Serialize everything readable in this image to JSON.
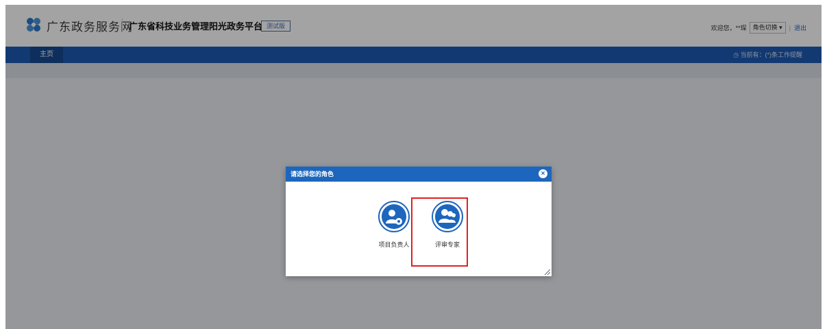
{
  "header": {
    "gov_name": "广东政务服务网",
    "platform_title": "广东省科技业务管理阳光政务平台",
    "beta_label": "测试版",
    "welcome": "欢迎您，**琛",
    "role_switch": "角色切换",
    "dropdown_arrow": "▾",
    "separator": "|",
    "logout": "退出"
  },
  "nav": {
    "home": "主页",
    "reminder_prefix": "当前有：(",
    "reminder_count": "*",
    "reminder_suffix": ")条工作提醒"
  },
  "dialog": {
    "title": "请选择您的角色",
    "roles": [
      {
        "label": "项目负责人",
        "icon": "user-gear-icon"
      },
      {
        "label": "评审专家",
        "icon": "user-group-icon"
      }
    ]
  },
  "colors": {
    "nav": "#1d5ab2",
    "dialog_header": "#1d66bd",
    "highlight": "#e02020"
  }
}
